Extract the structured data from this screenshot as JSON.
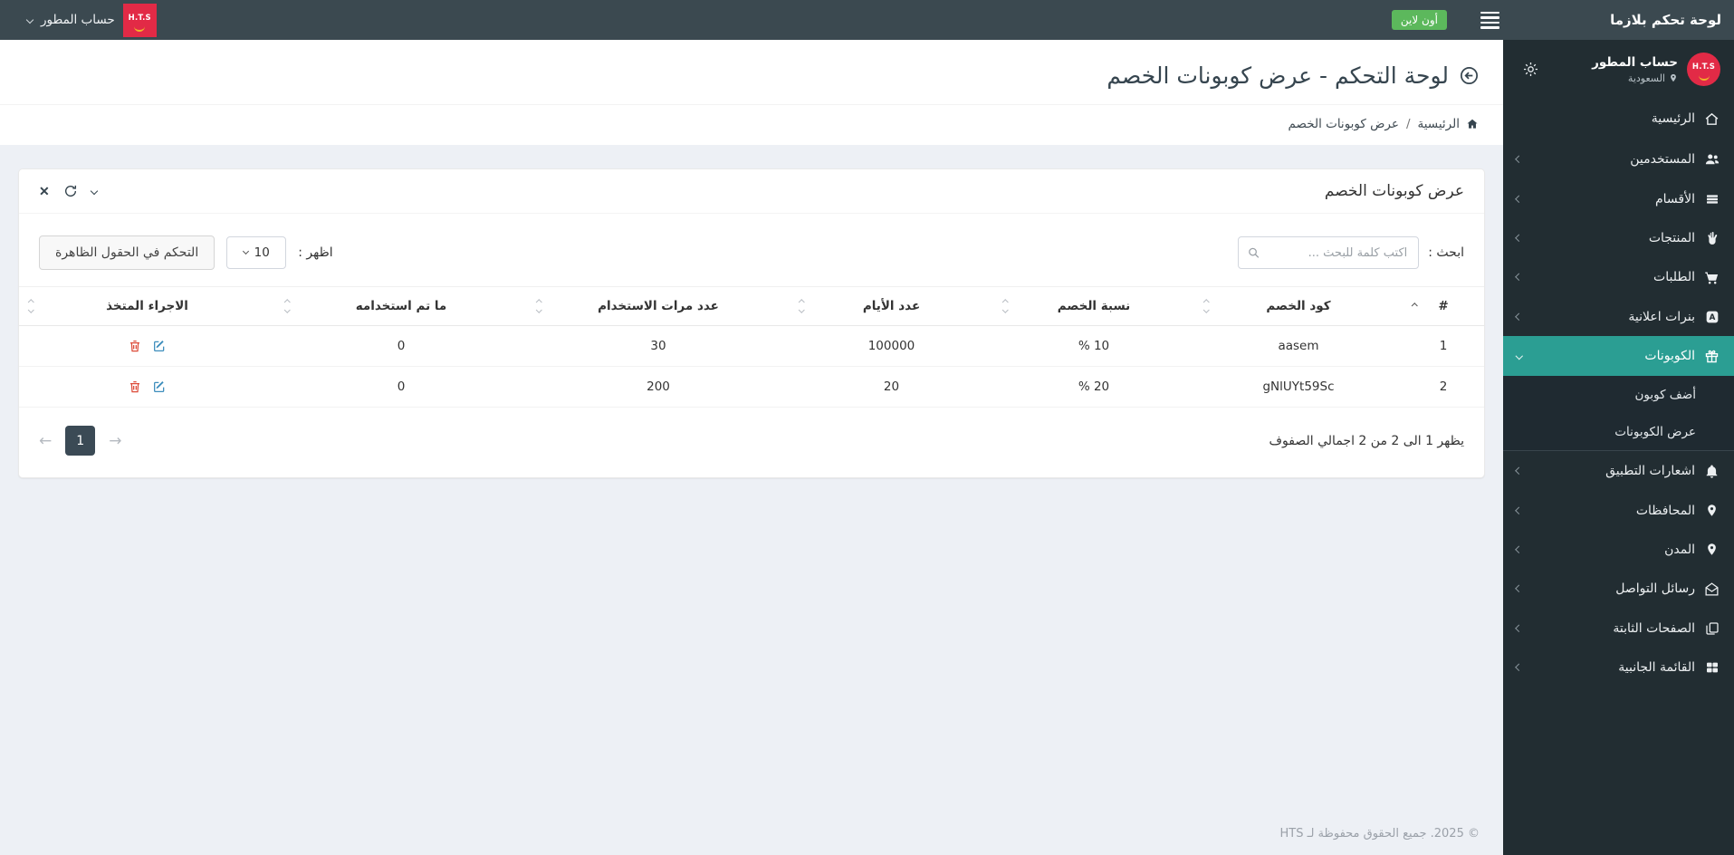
{
  "topbar": {
    "brand": "لوحة تحكم بلازما",
    "online_badge": "أون لاين",
    "account": {
      "label": "حساب المطور",
      "logo_text": "H.T.S"
    }
  },
  "sidebar": {
    "profile": {
      "name": "حساب المطور",
      "location": "السعودية",
      "avatar_text": "H.T.S"
    },
    "items": [
      {
        "label": "الرئيسية",
        "icon": "home-icon"
      },
      {
        "label": "المستخدمين",
        "icon": "users-icon"
      },
      {
        "label": "الأقسام",
        "icon": "sections-icon"
      },
      {
        "label": "المنتجات",
        "icon": "products-icon"
      },
      {
        "label": "الطلبات",
        "icon": "cart-icon"
      },
      {
        "label": "بنرات اعلانية",
        "icon": "ad-banner-icon"
      },
      {
        "label": "الكوبونات",
        "icon": "gift-icon",
        "active": true,
        "expanded": true
      },
      {
        "label": "اشعارات التطبيق",
        "icon": "bell-icon"
      },
      {
        "label": "المحافظات",
        "icon": "map-marker-icon"
      },
      {
        "label": "المدن",
        "icon": "map-marker-icon"
      },
      {
        "label": "رسائل التواصل",
        "icon": "envelope-icon"
      },
      {
        "label": "الصفحات الثابتة",
        "icon": "pages-icon"
      },
      {
        "label": "القائمة الجانبية",
        "icon": "grid-icon"
      }
    ],
    "coupons_submenu": [
      {
        "label": "أضف كوبون"
      },
      {
        "label": "عرض الكوبونات"
      }
    ]
  },
  "header": {
    "title": "لوحة التحكم - عرض كوبونات الخصم",
    "icon": "arrow-circle-left-icon"
  },
  "breadcrumb": {
    "home_label": "الرئيسية",
    "separator": "/",
    "current": "عرض كوبونات الخصم"
  },
  "card": {
    "title": "عرض كوبونات الخصم",
    "tools": {
      "close": "✕"
    },
    "search": {
      "label": "ابحث :",
      "placeholder": "اكتب كلمة للبحث ..."
    },
    "display": {
      "label": "اظهر :",
      "page_size": "10",
      "columns_button": "التحكم في الحقول الظاهرة"
    },
    "table": {
      "headers": [
        {
          "label": "#",
          "sort": "asc"
        },
        {
          "label": "كود الخصم",
          "sort": "none"
        },
        {
          "label": "نسبة الخصم",
          "sort": "none"
        },
        {
          "label": "عدد الأيام",
          "sort": "none"
        },
        {
          "label": "عدد مرات الاستخدام",
          "sort": "none"
        },
        {
          "label": "ما تم استخدامه",
          "sort": "none"
        },
        {
          "label": "الاجراء المتخذ",
          "sort": "none"
        }
      ],
      "rows": [
        {
          "index": "1",
          "code": "aasem",
          "discount": "% 10",
          "days": "100000",
          "max_uses": "30",
          "used": "0"
        },
        {
          "index": "2",
          "code": "gNlUYt59Sc",
          "discount": "% 20",
          "days": "20",
          "max_uses": "200",
          "used": "0"
        }
      ],
      "row_action_icons": [
        "trash-icon",
        "edit-icon"
      ]
    },
    "footer": {
      "info": "يظهر 1 الى 2 من 2 اجمالي الصفوف",
      "pagination": {
        "prev": "←",
        "current_page": "1",
        "next": "→"
      }
    }
  },
  "page_footer": {
    "copyright": "© 2025. جميع الحقوق محفوظة لـ HTS"
  },
  "colors": {
    "accent_teal": "#2b9e93",
    "brand_red": "#e22a46",
    "online_green": "#5cb85c",
    "danger_red": "#dd4b39",
    "info_blue": "#3c8dbc",
    "topbar_bg": "#3b4950",
    "sidebar_bg": "#222d32",
    "body_bg": "#edf0f5"
  }
}
